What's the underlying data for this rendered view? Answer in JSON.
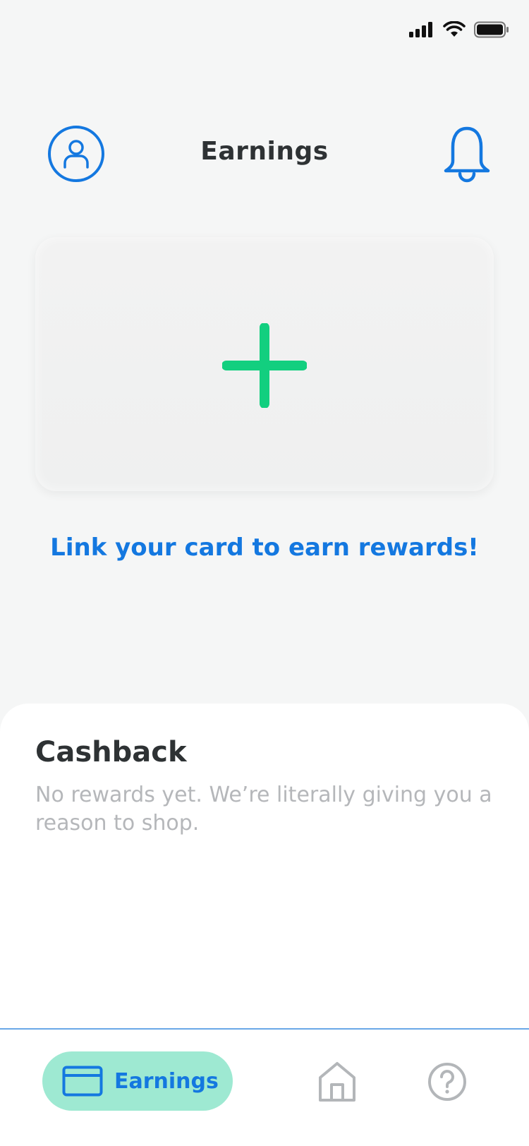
{
  "header": {
    "title": "Earnings",
    "profile_icon": "user-icon",
    "notifications_icon": "bell-icon"
  },
  "add_card": {
    "icon": "plus-icon",
    "link_text": "Link your card to earn rewards!"
  },
  "cashback": {
    "title": "Cashback",
    "empty_text": "No rewards yet. We’re literally giving you a reason to shop."
  },
  "tab_bar": {
    "items": [
      {
        "label": "Earnings",
        "icon": "card-icon",
        "active": true
      },
      {
        "label": "",
        "icon": "home-icon",
        "active": false
      },
      {
        "label": "",
        "icon": "help-icon",
        "active": false
      }
    ]
  },
  "colors": {
    "accent": "#1478e0",
    "plus_green": "#12cf7f",
    "active_tab_bg": "#9ee9d2",
    "background": "#f5f6f6",
    "title_text": "#2e3234",
    "muted_text": "#b5b7ba"
  }
}
